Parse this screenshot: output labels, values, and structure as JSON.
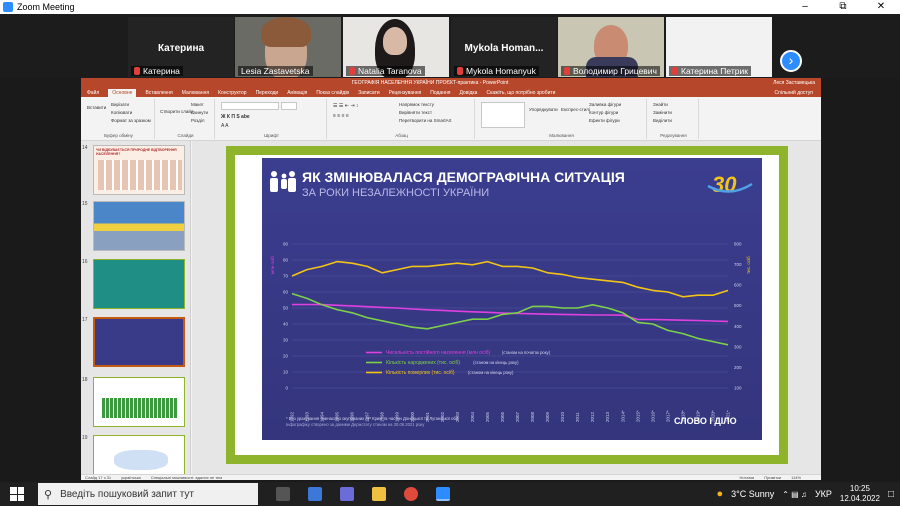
{
  "window": {
    "title": "Zoom Meeting"
  },
  "participants": [
    {
      "name": "Катерина",
      "label": "Катерина",
      "video": false
    },
    {
      "name": "",
      "label": "Lesia Zastavetska",
      "video": true
    },
    {
      "name": "",
      "label": "Natalia Taranova",
      "video": true
    },
    {
      "name": "Mykola  Homan...",
      "label": "Mykola Homanyuk",
      "video": false
    },
    {
      "name": "",
      "label": "Володимир Грицевич",
      "video": true
    },
    {
      "name": "",
      "label": "Катерина Петрик",
      "video": true
    }
  ],
  "ppt": {
    "title": "ГЕОГРАФІЯ НАСЕЛЕННЯ УКРАЇНИ ПРОЄКТ-практика - PowerPoint",
    "user": "Леся Заставецька",
    "tabs": [
      "Файл",
      "Основне",
      "Вставлення",
      "Малювання",
      "Конструктор",
      "Переходи",
      "Анімація",
      "Показ слайдів",
      "Записати",
      "Рецензування",
      "Подання",
      "Довідка",
      "Скажіть, що потрібно зробити"
    ],
    "share_label": "Спільний доступ",
    "ribbon_groups": [
      "Буфер обміну",
      "Слайди",
      "Шрифт",
      "Абзац",
      "Малювання",
      "Редагування"
    ],
    "ribbon_buttons": {
      "paste": "Вставити",
      "cut": "Вирізати",
      "copy": "Копіювати",
      "format": "Формат за зразком",
      "new_slide": "Створити слайд",
      "layout": "Макет",
      "reset": "Скинути",
      "section": "Розділ",
      "arrange": "Упорядкувати",
      "quick_styles": "Експрес-стилі",
      "fill": "Заливка фігури",
      "outline": "Контур фігури",
      "effects": "Ефекти фігури",
      "find": "Знайти",
      "replace": "Замінити",
      "select": "Виділити",
      "text_dir": "Напрямок тексту",
      "align_text": "Вирівняти текст",
      "smartart": "Перетворити на SmartArt"
    },
    "thumb_numbers": [
      "14",
      "15",
      "16",
      "17",
      "18",
      "19"
    ],
    "thumb_captions": {
      "t14": "ЧИ ВІДБУВАЄТЬСЯ ПРИРОДНЕ ВІДТВОРЕННЯ НАСЕЛЕННЯ?"
    },
    "status": {
      "slide": "Слайд 17 з 31",
      "lang": "українська",
      "access": "Спеціальні можливості: вдалих не тем",
      "notes": "Нотатки",
      "comments": "Примітки",
      "zoom": "114%"
    }
  },
  "infographic": {
    "title": "ЯК ЗМІНЮВАЛАСЯ ДЕМОГРАФІЧНА СИТУАЦІЯ",
    "subtitle": "ЗА РОКИ НЕЗАЛЕЖНОСТІ УКРАЇНИ",
    "badge": "30",
    "legend": [
      {
        "label": "Чисельність постійного населення (млн осіб)",
        "note": "(станом на початок року)",
        "color": "#e040e0"
      },
      {
        "label": "Кількість народжених (тис. осіб)",
        "note": "(станом на кінець року)",
        "color": "#7dd14a"
      },
      {
        "label": "Кількість померлих (тис. осіб)",
        "note": "(станом на кінець року)",
        "color": "#f2c418"
      }
    ],
    "footnote1": "* Без урахування тимчасово окупованих АР Крим та частин Донецької та Луганської обл.",
    "footnote2": "Інфографіку створено за даними Держстату станом на 30.06.2021 року",
    "brand": "СЛОВО І ДІЛО",
    "left_axis_label": "млн осіб",
    "right_axis_label": "тис. осіб"
  },
  "chart_data": {
    "type": "line",
    "x": [
      "1992",
      "1993",
      "1994",
      "1995",
      "1996",
      "1997",
      "1998",
      "1999",
      "2000",
      "2001",
      "2002",
      "2003",
      "2004",
      "2005",
      "2006",
      "2007",
      "2008",
      "2009",
      "2010",
      "2011",
      "2012",
      "2013",
      "2014*",
      "2015*",
      "2016*",
      "2017*",
      "2018*",
      "2019*",
      "2020*",
      "2021*"
    ],
    "left_axis": {
      "ticks": [
        0,
        10,
        20,
        30,
        40,
        50,
        60,
        70,
        80,
        90
      ],
      "label": "млн осіб"
    },
    "right_axis": {
      "ticks": [
        100,
        200,
        300,
        400,
        500,
        600,
        700,
        800
      ],
      "label": "тис. осіб"
    },
    "series": [
      {
        "name": "Чисельність постійного населення (млн осіб)",
        "axis": "left",
        "values": [
          52.1,
          52.2,
          52.1,
          51.7,
          51.3,
          50.8,
          50.4,
          50.0,
          49.4,
          48.9,
          48.5,
          48.0,
          47.6,
          47.3,
          46.9,
          46.6,
          46.4,
          46.1,
          46.0,
          45.8,
          45.6,
          45.6,
          45.5,
          42.9,
          42.8,
          42.6,
          42.4,
          42.2,
          41.9,
          41.6
        ]
      },
      {
        "name": "Кількість народжених (тис. осіб)",
        "axis": "left",
        "values": [
          59,
          56,
          52,
          49,
          47,
          44,
          42,
          40,
          38,
          37,
          39,
          41,
          43,
          43,
          46,
          47,
          51,
          51,
          50,
          50,
          52,
          50,
          47,
          41,
          40,
          36,
          34,
          31,
          29,
          27
        ]
      },
      {
        "name": "Кількість померлих (тис. осіб)",
        "axis": "left",
        "values": [
          70,
          74,
          76,
          79,
          78,
          76,
          72,
          74,
          76,
          76,
          77,
          78,
          77,
          79,
          76,
          76,
          75,
          72,
          71,
          69,
          68,
          67,
          66,
          63,
          61,
          60,
          57,
          58,
          58,
          61
        ]
      }
    ]
  },
  "taskbar": {
    "search_placeholder": "Введіть пошуковий запит тут",
    "weather": "3°C  Sunny",
    "lang": "УКР",
    "time": "10:25",
    "date": "12.04.2022"
  }
}
